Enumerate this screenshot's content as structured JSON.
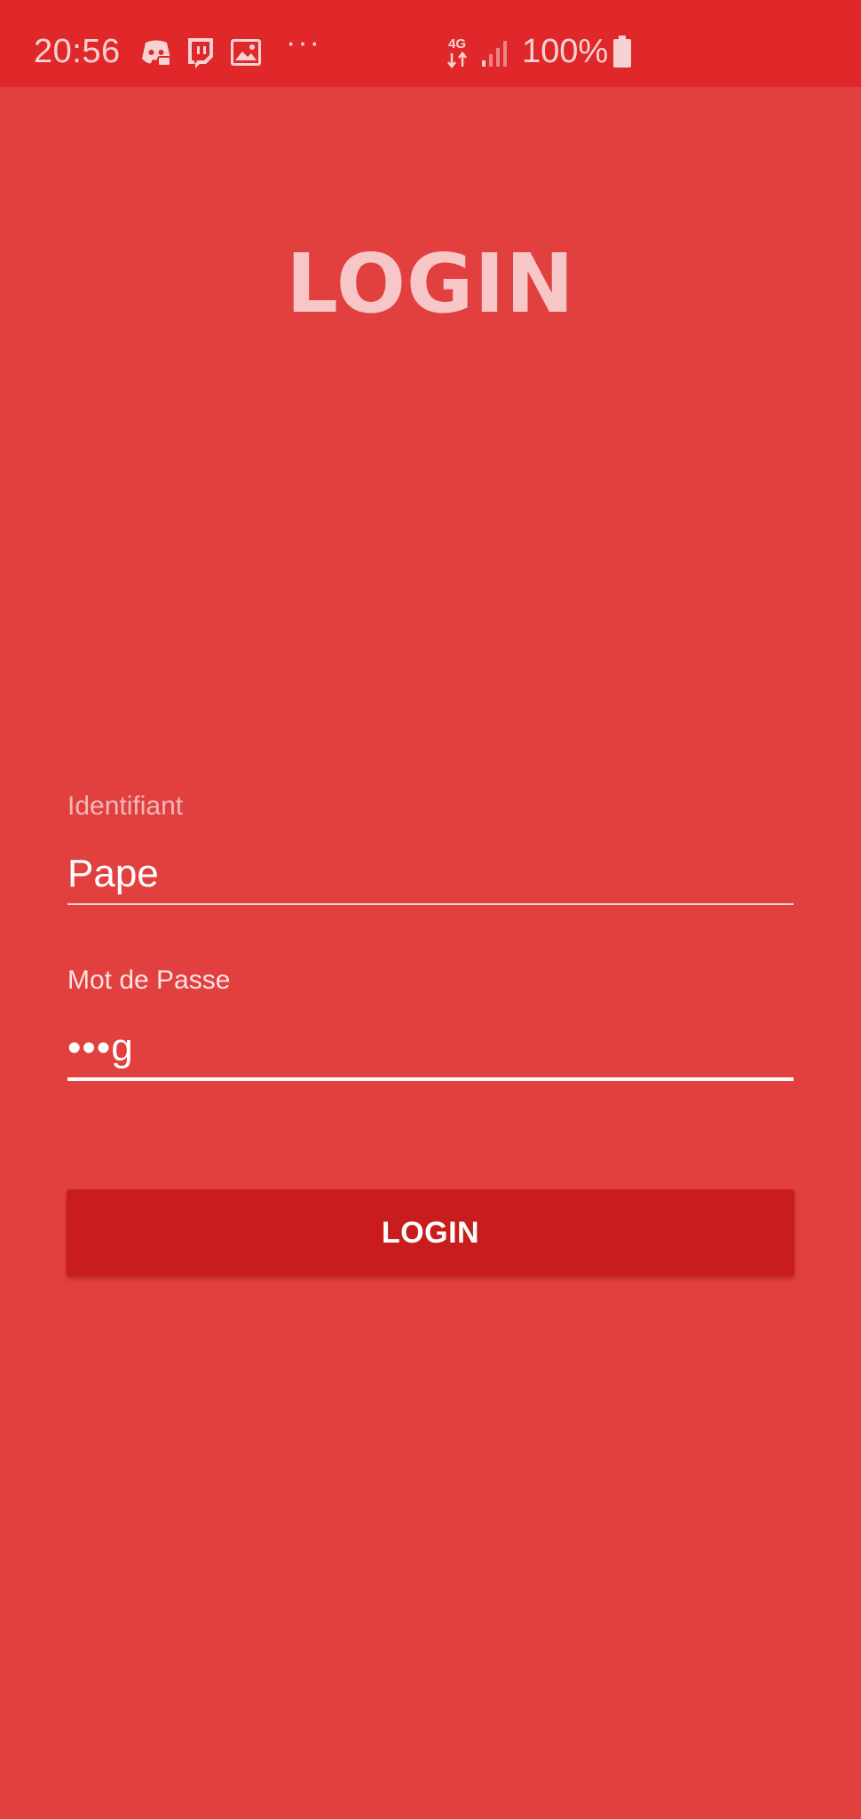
{
  "status_bar": {
    "time": "20:56",
    "more_dots": "···",
    "network": "4G",
    "battery": "100%",
    "icons": [
      "discord-icon",
      "twitch-icon",
      "gallery-icon",
      "network-4g-icon",
      "signal-icon",
      "battery-icon"
    ]
  },
  "page": {
    "title": "LOGIN"
  },
  "form": {
    "username_label": "Identifiant",
    "username_value": "Pape",
    "password_label": "Mot de Passe",
    "password_value": "•••g",
    "submit_label": "LOGIN"
  },
  "colors": {
    "background": "#e23f3f",
    "status_bar": "#e0282b",
    "title": "#f7c7c8",
    "button": "#c91c1c",
    "text": "#ffffff"
  }
}
